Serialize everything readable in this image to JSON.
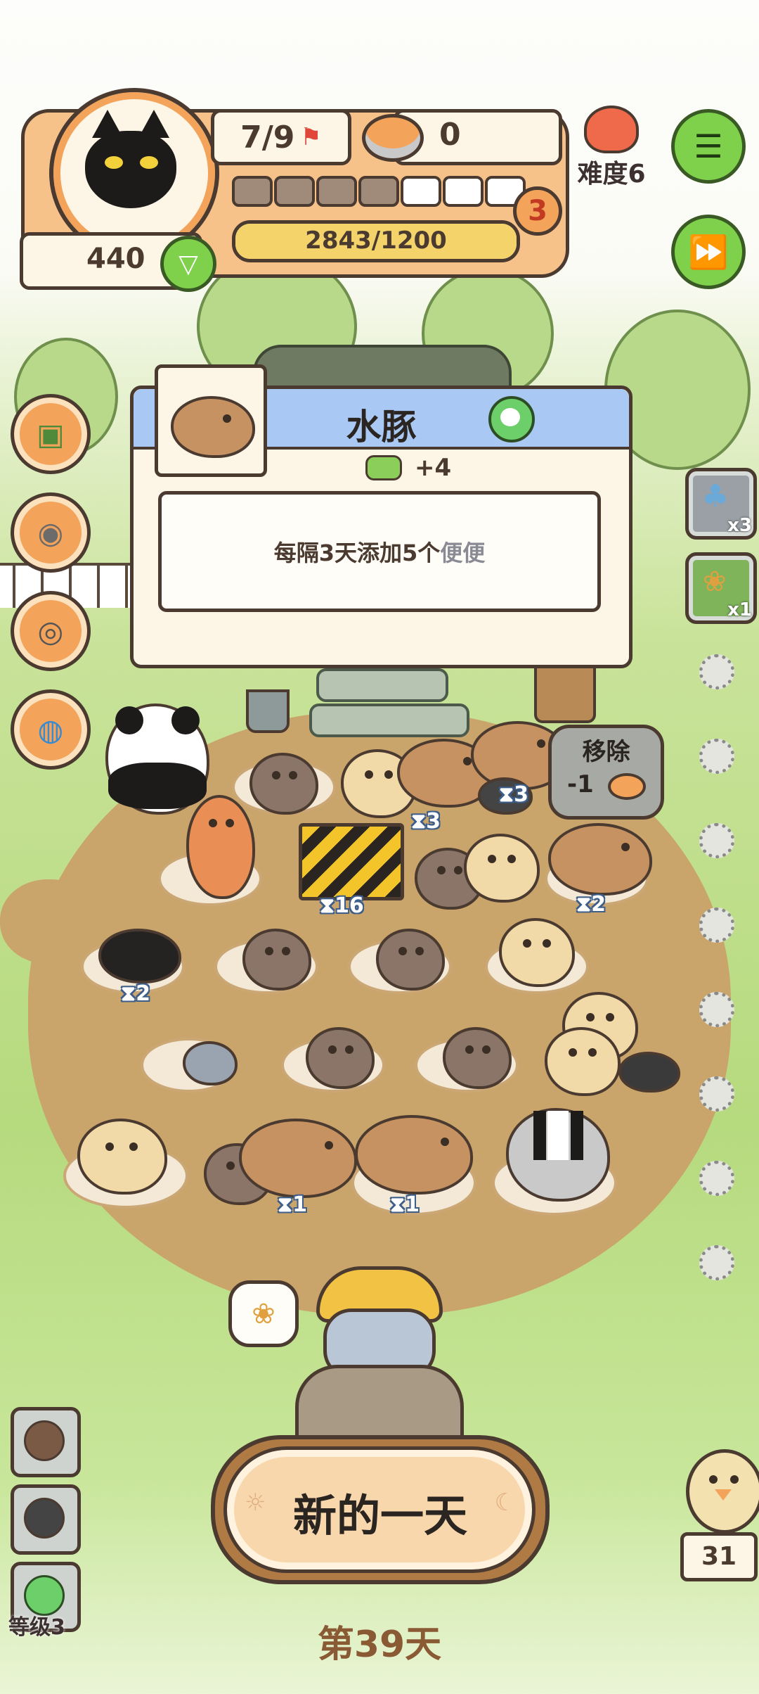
{
  "hud": {
    "stage_progress": "7/9",
    "coins": "440",
    "food_count": "0",
    "xp_text": "2843/1200",
    "xp_fraction": 1.0,
    "level_badge": "3",
    "segments_filled": 4,
    "segments_total": 7,
    "difficulty": "难度6"
  },
  "popup": {
    "title": "水豚",
    "resource_delta": "+4",
    "description_main": "每隔3天添加5个",
    "description_highlight": "便便"
  },
  "inventory": [
    {
      "icon": "mushroom-icon",
      "count": "x3"
    },
    {
      "icon": "food-pellet-icon",
      "count": "x1"
    }
  ],
  "remove_bubble": {
    "title": "移除",
    "cost": "-1"
  },
  "timers": {
    "t1": "3",
    "t2": "3",
    "t3": "16",
    "t4": "2",
    "t5": "2",
    "t6": "1",
    "t7": "1"
  },
  "bottom": {
    "new_day_button": "新的一天",
    "day_label": "第39天",
    "level_label": "等级3",
    "counter": "31"
  },
  "colors": {
    "accent_orange": "#f3a35a",
    "panel_cream": "#fdf6e7",
    "popup_header_blue": "#a9c8f3",
    "xp_yellow": "#f4d46a",
    "green_button": "#7fd04a"
  }
}
